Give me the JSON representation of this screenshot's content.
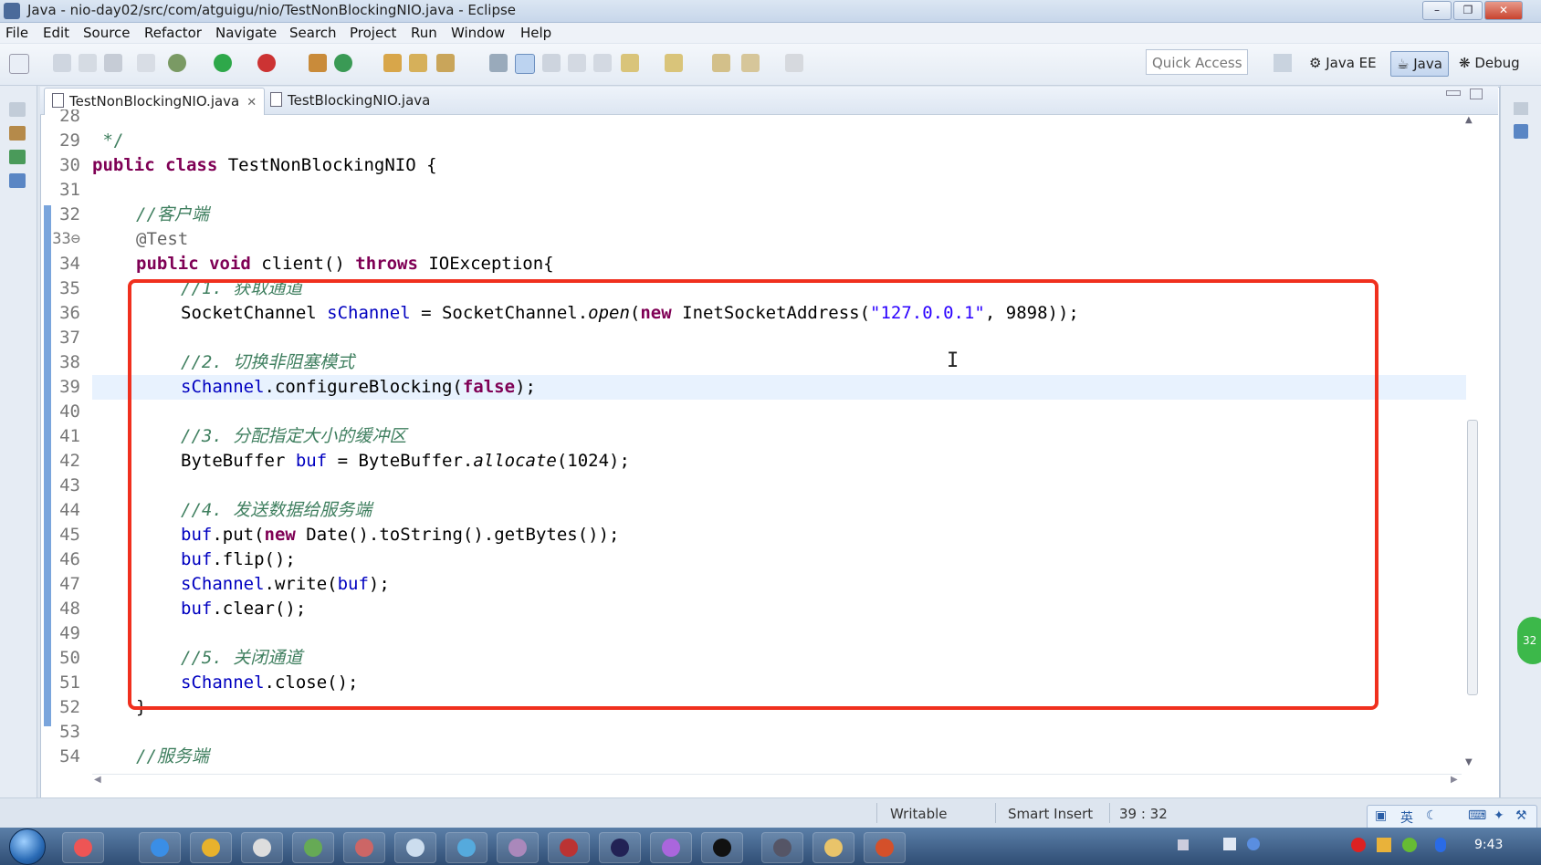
{
  "window": {
    "title": "Java - nio-day02/src/com/atguigu/nio/TestNonBlockingNIO.java - Eclipse"
  },
  "menu": [
    "File",
    "Edit",
    "Source",
    "Refactor",
    "Navigate",
    "Search",
    "Project",
    "Run",
    "Window",
    "Help"
  ],
  "toolbar": {
    "quick_access": "Quick Access"
  },
  "perspectives": {
    "java_ee": "Java EE",
    "java": "Java",
    "debug": "Debug"
  },
  "tabs": [
    {
      "label": "TestNonBlockingNIO.java",
      "active": true
    },
    {
      "label": "TestBlockingNIO.java",
      "active": false
    }
  ],
  "editor": {
    "line_numbers": [
      "28",
      "29",
      "30",
      "31",
      "32",
      "33⊖",
      "34",
      "35",
      "36",
      "37",
      "38",
      "39",
      "40",
      "41",
      "42",
      "43",
      "44",
      "45",
      "46",
      "47",
      "48",
      "49",
      "50",
      "51",
      "52",
      "53",
      "54"
    ],
    "code": {
      "l29": " */",
      "l30_kw1": "public",
      "l30_kw2": "class",
      "l30_rest": " TestNonBlockingNIO {",
      "l32": "//客户端",
      "l33": "@Test",
      "l34_kw1": "public",
      "l34_kw2": "void",
      "l34_mid": " client() ",
      "l34_kw3": "throws",
      "l34_rest": " IOException{",
      "l35": "//1. 获取通道",
      "l36_a": "SocketChannel ",
      "l36_var": "sChannel",
      "l36_b": " = SocketChannel.",
      "l36_open": "open",
      "l36_c": "(",
      "l36_new": "new",
      "l36_d": " InetSocketAddress(",
      "l36_str": "\"127.0.0.1\"",
      "l36_e": ", 9898));",
      "l38": "//2. 切换非阻塞模式",
      "l39_var": "sChannel",
      "l39_a": ".configureBlocking(",
      "l39_false": "false",
      "l39_b": ");",
      "l41": "//3. 分配指定大小的缓冲区",
      "l42_a": "ByteBuffer ",
      "l42_var": "buf",
      "l42_b": " = ByteBuffer.",
      "l42_alloc": "allocate",
      "l42_c": "(1024);",
      "l44": "//4. 发送数据给服务端",
      "l45_var": "buf",
      "l45_a": ".put(",
      "l45_new": "new",
      "l45_b": " Date().toString().getBytes());",
      "l46_var": "buf",
      "l46_a": ".flip();",
      "l47_var": "sChannel",
      "l47_a": ".write(",
      "l47_var2": "buf",
      "l47_b": ");",
      "l48_var": "buf",
      "l48_a": ".clear();",
      "l50": "//5. 关闭通道",
      "l51_var": "sChannel",
      "l51_a": ".close();",
      "l52": "}",
      "l54": "//服务端"
    }
  },
  "status": {
    "writable": "Writable",
    "insert_mode": "Smart Insert",
    "position": "39 : 32"
  },
  "ime": {
    "lang": "英"
  },
  "tray": {
    "clock": "9:43",
    "badge": "32"
  },
  "colors": {
    "keyword": "#7f0055",
    "comment": "#3f7f5f",
    "string": "#2a00ff",
    "field": "#0000c0",
    "highlight_box": "#f0301e"
  }
}
